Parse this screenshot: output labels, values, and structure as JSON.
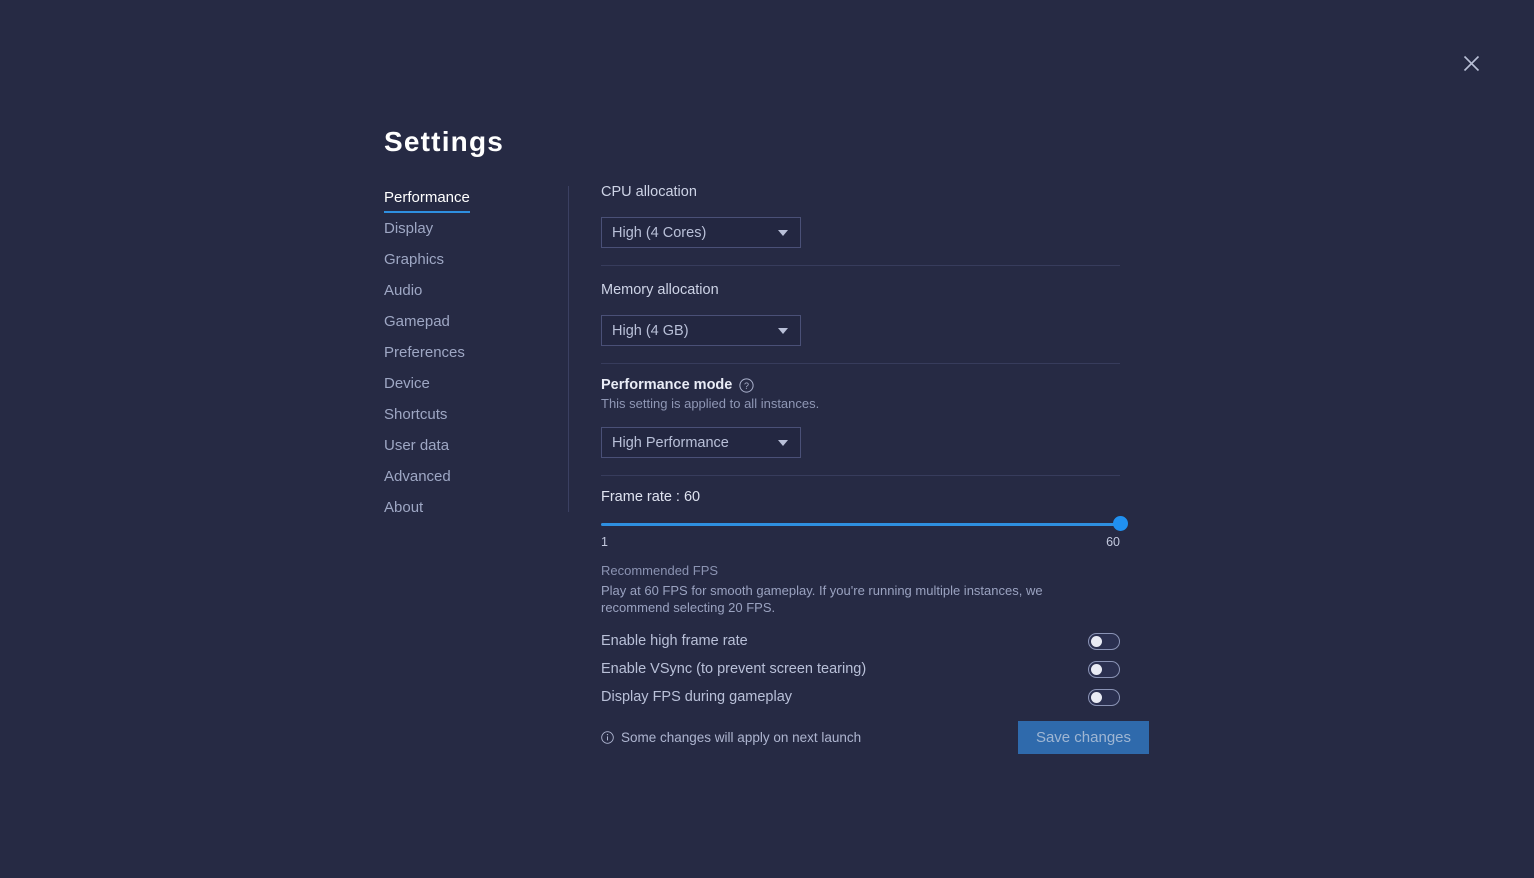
{
  "window": {
    "title": "Settings",
    "close_icon": "close-icon"
  },
  "sidebar": {
    "items": [
      {
        "label": "Performance",
        "active": true
      },
      {
        "label": "Display",
        "active": false
      },
      {
        "label": "Graphics",
        "active": false
      },
      {
        "label": "Audio",
        "active": false
      },
      {
        "label": "Gamepad",
        "active": false
      },
      {
        "label": "Preferences",
        "active": false
      },
      {
        "label": "Device",
        "active": false
      },
      {
        "label": "Shortcuts",
        "active": false
      },
      {
        "label": "User data",
        "active": false
      },
      {
        "label": "Advanced",
        "active": false
      },
      {
        "label": "About",
        "active": false
      }
    ]
  },
  "content": {
    "cpu": {
      "label": "CPU allocation",
      "value": "High (4 Cores)",
      "caret_icon": "chevron-down-icon"
    },
    "memory": {
      "label": "Memory allocation",
      "value": "High (4 GB)",
      "caret_icon": "chevron-down-icon"
    },
    "performance_mode": {
      "label": "Performance mode",
      "help_icon": "help-circle-icon",
      "note": "This setting is applied to all instances.",
      "value": "High Performance",
      "caret_icon": "chevron-down-icon"
    },
    "frame_rate": {
      "label": "Frame rate : 60",
      "value": 60,
      "min": 1,
      "max": 60,
      "min_label": "1",
      "max_label": "60",
      "percent": 100,
      "recommended_title": "Recommended FPS",
      "recommended_body": "Play at 60 FPS for smooth gameplay. If you're running multiple instances, we recommend selecting 20 FPS."
    },
    "toggles": [
      {
        "label": "Enable high frame rate",
        "on": false
      },
      {
        "label": "Enable VSync (to prevent screen tearing)",
        "on": false
      },
      {
        "label": "Display FPS during gameplay",
        "on": false
      }
    ]
  },
  "footer": {
    "info_icon": "info-circle-icon",
    "note": "Some changes will apply on next launch",
    "save_label": "Save changes"
  },
  "colors": {
    "background": "#262a44",
    "accent": "#2e8fe0",
    "slider_thumb": "#2090f0",
    "save_button": "#2f6aac",
    "divider": "#373c5c"
  }
}
